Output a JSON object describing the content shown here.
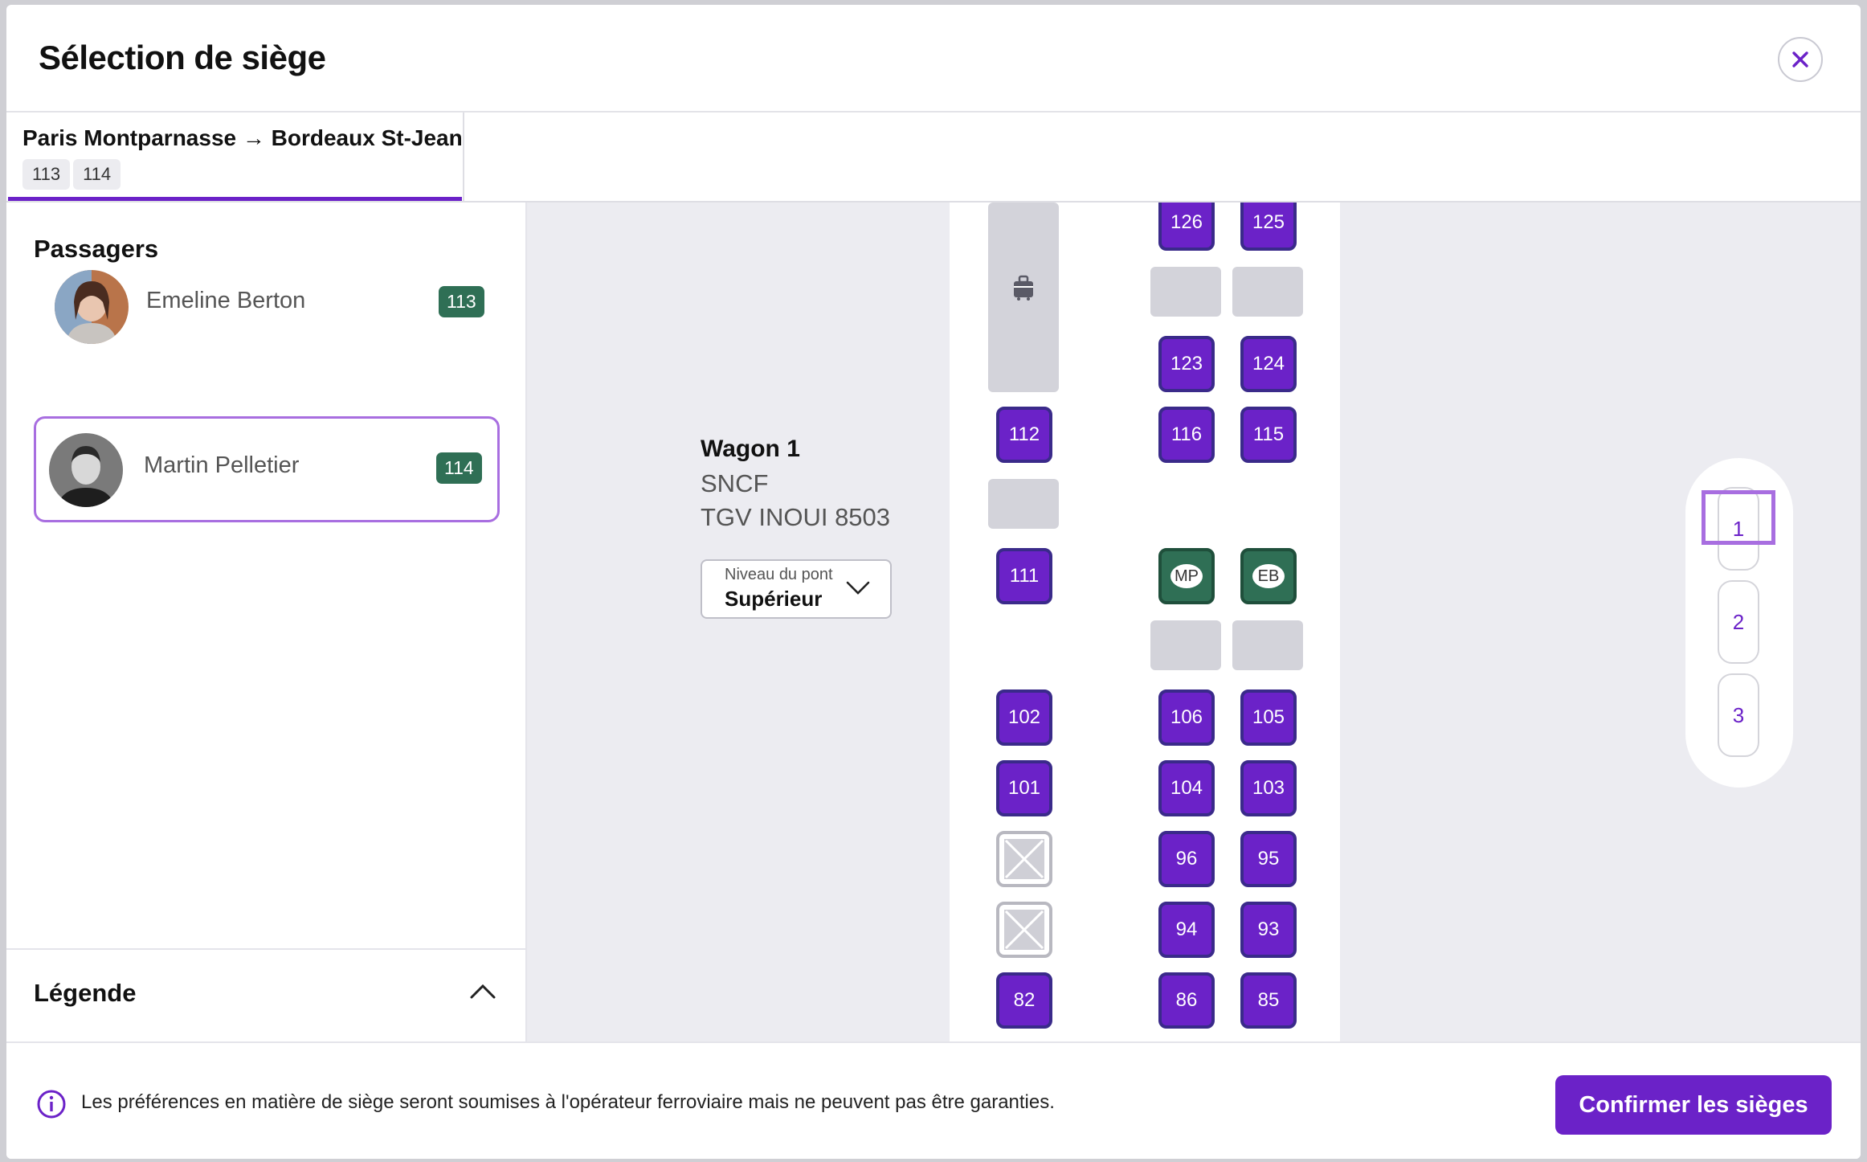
{
  "dialog": {
    "title": "Sélection de siège",
    "close_icon": "close-icon"
  },
  "tab": {
    "route": "Paris Montparnasse → Bordeaux St-Jean",
    "seats": [
      "113",
      "114"
    ]
  },
  "passengers": {
    "title": "Passagers",
    "items": [
      {
        "name": "Emeline Berton",
        "seat": "113",
        "selected": false
      },
      {
        "name": "Martin Pelletier",
        "seat": "114",
        "selected": true
      }
    ]
  },
  "legend": {
    "title": "Légende",
    "icon": "chevron-up-icon"
  },
  "wagon": {
    "name": "Wagon 1",
    "operator": "SNCF",
    "train": "TGV INOUI 8503",
    "deck_label": "Niveau du pont",
    "deck_value": "Supérieur"
  },
  "seats": {
    "left_column": [
      "112",
      "111",
      "102",
      "101",
      "82"
    ],
    "middle_column": [
      "126",
      "123",
      "116",
      "106",
      "104",
      "96",
      "94",
      "86"
    ],
    "right_column": [
      "125",
      "124",
      "115",
      "105",
      "103",
      "95",
      "93",
      "85"
    ],
    "occupied": [
      "MP",
      "EB"
    ]
  },
  "minimap": {
    "cars": [
      "1",
      "2",
      "3"
    ],
    "selected": "1"
  },
  "footer": {
    "notice": "Les préférences en matière de siège seront soumises à l'opérateur ferroviaire mais ne peuvent pas être garanties.",
    "confirm_label": "Confirmer les sièges"
  },
  "colors": {
    "accent": "#6b22c8",
    "seat_taken": "#2f6f55",
    "badge": "#2f6f55",
    "selected_border": "#a86ee0"
  }
}
